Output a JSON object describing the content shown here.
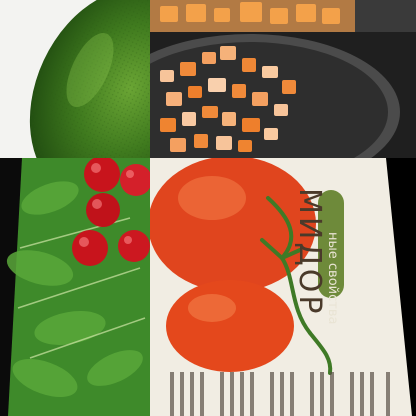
{
  "collage": {
    "tiles": [
      {
        "subject": "avocado"
      },
      {
        "subject": "diced-carrots"
      },
      {
        "subject": "radishes"
      },
      {
        "subject": "tomatoes"
      }
    ]
  },
  "magazine": {
    "title": "МИДОР",
    "subtitle": "ные свойства"
  },
  "colors": {
    "avocado_skin": "#3f7a1e",
    "carrot": "#f08a3a",
    "radish": "#c8141c",
    "tomato": "#e0451e",
    "leaf": "#3e8a2a",
    "page": "#f1ede3",
    "label_band": "#6e8a3a"
  }
}
